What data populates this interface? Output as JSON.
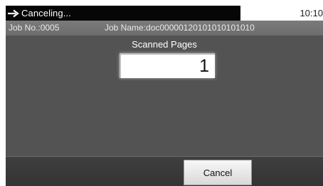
{
  "status": {
    "icon": "right-arrow-icon",
    "text": "Canceling...",
    "time": "10:10"
  },
  "job": {
    "number_label": "Job No.:0005",
    "name_label": "Job Name:doc00000120101010101010"
  },
  "scan": {
    "label": "Scanned Pages",
    "count": "1"
  },
  "actions": {
    "cancel_label": "Cancel"
  },
  "colors": {
    "status_bar": "#060606",
    "panel": "#535353",
    "job_bar": "#737373",
    "bottom_bar": "#393939"
  }
}
